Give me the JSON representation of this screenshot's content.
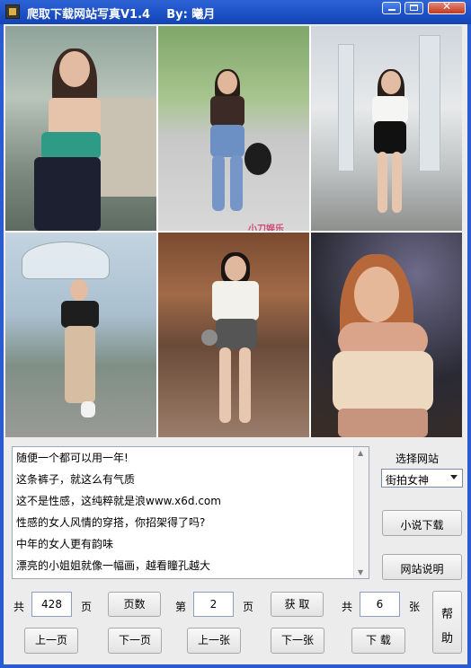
{
  "window": {
    "title": "爬取下载网站写真V1.4    By: 曦月",
    "minimize_icon": "minimize-icon",
    "maximize_icon": "maximize-icon",
    "close_icon": "close-icon",
    "titlebar_color": "#1f55c8"
  },
  "photos": {
    "watermark": "小刀娱乐"
  },
  "text_list": {
    "lines": [
      "随便一个都可以用一年!",
      "这条裤子，就这么有气质",
      "这不是性感，这纯粹就是浪www.x6d.com",
      "性感的女人风情的穿搭，你招架得了吗?",
      "中年的女人更有韵味",
      "漂亮的小姐姐就像一幅画，越看瞳孔越大"
    ]
  },
  "side": {
    "site_label": "选择网站",
    "site_selected": "街拍女神",
    "novel_download": "小说下载",
    "site_info": "网站说明"
  },
  "controls": {
    "total_prefix": "共",
    "total_pages": "428",
    "page_unit": "页",
    "page_count_btn": "页数",
    "page_prefix": "第",
    "current_page": "2",
    "page_unit2": "页",
    "fetch_btn": "获 取",
    "count_prefix": "共",
    "image_count": "6",
    "image_unit": "张",
    "help_line1": "帮",
    "help_line2": "助",
    "prev_page": "上一页",
    "next_page": "下一页",
    "prev_image": "上一张",
    "next_image": "下一张",
    "download": "下 载"
  }
}
